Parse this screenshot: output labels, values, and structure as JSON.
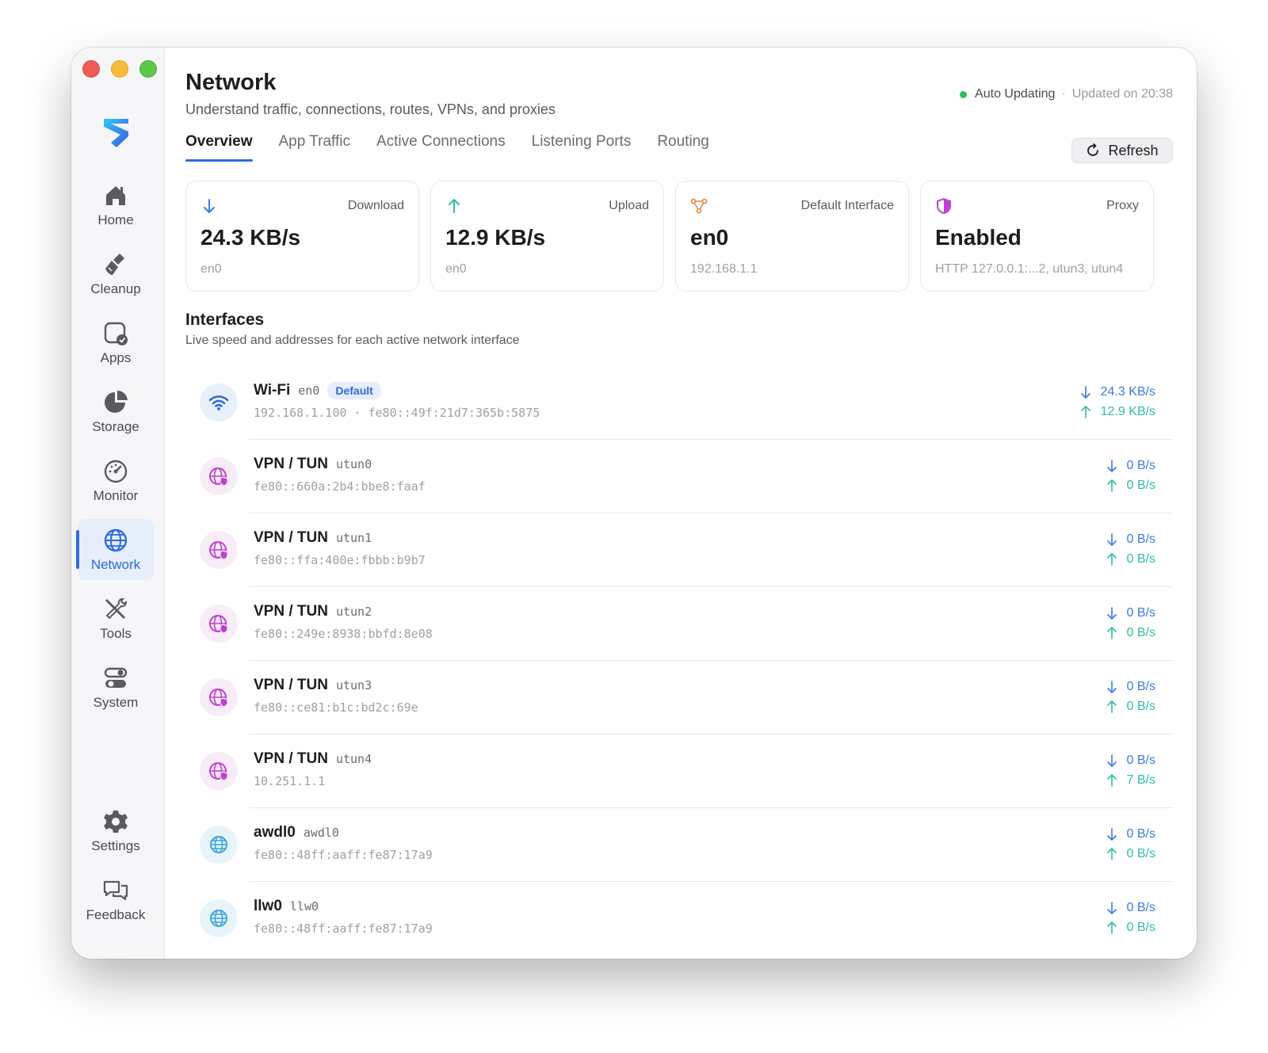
{
  "sidebar": {
    "items": [
      {
        "label": "Home",
        "icon": "house-icon"
      },
      {
        "label": "Cleanup",
        "icon": "broom-icon"
      },
      {
        "label": "Apps",
        "icon": "apps-icon"
      },
      {
        "label": "Storage",
        "icon": "pie-chart-icon"
      },
      {
        "label": "Monitor",
        "icon": "gauge-icon"
      },
      {
        "label": "Network",
        "icon": "globe-icon",
        "active": true
      },
      {
        "label": "Tools",
        "icon": "tools-icon"
      },
      {
        "label": "System",
        "icon": "toggles-icon"
      }
    ],
    "bottom": [
      {
        "label": "Settings",
        "icon": "gear-icon"
      },
      {
        "label": "Feedback",
        "icon": "chat-bubbles-icon"
      }
    ]
  },
  "header": {
    "title": "Network",
    "subtitle": "Understand traffic, connections, routes, VPNs, and proxies",
    "status_auto": "Auto Updating",
    "status_sep": "·",
    "status_updated": "Updated on 20:38",
    "refresh_label": "Refresh"
  },
  "tabs": [
    {
      "label": "Overview",
      "active": true
    },
    {
      "label": "App Traffic"
    },
    {
      "label": "Active Connections"
    },
    {
      "label": "Listening Ports"
    },
    {
      "label": "Routing"
    }
  ],
  "stats": {
    "download": {
      "label": "Download",
      "value": "24.3 KB/s",
      "sub": "en0"
    },
    "upload": {
      "label": "Upload",
      "value": "12.9 KB/s",
      "sub": "en0"
    },
    "interface": {
      "label": "Default Interface",
      "value": "en0",
      "sub": "192.168.1.1"
    },
    "proxy": {
      "label": "Proxy",
      "value": "Enabled",
      "sub": "HTTP 127.0.0.1:...2, utun3, utun4"
    }
  },
  "interfaces_section": {
    "title": "Interfaces",
    "subtitle": "Live speed and addresses for each active network interface"
  },
  "interfaces": [
    {
      "name": "Wi-Fi",
      "dev": "en0",
      "badge": "Default",
      "addr": "192.168.1.100  ·  fe80::49f:21d7:365b:5875",
      "down": "24.3 KB/s",
      "up": "12.9 KB/s"
    },
    {
      "name": "VPN / TUN",
      "dev": "utun0",
      "addr": "fe80::660a:2b4:bbe8:faaf",
      "down": "0 B/s",
      "up": "0 B/s"
    },
    {
      "name": "VPN / TUN",
      "dev": "utun1",
      "addr": "fe80::ffa:400e:fbbb:b9b7",
      "down": "0 B/s",
      "up": "0 B/s"
    },
    {
      "name": "VPN / TUN",
      "dev": "utun2",
      "addr": "fe80::249e:8938:bbfd:8e08",
      "down": "0 B/s",
      "up": "0 B/s"
    },
    {
      "name": "VPN / TUN",
      "dev": "utun3",
      "addr": "fe80::ce81:b1c:bd2c:69e",
      "down": "0 B/s",
      "up": "0 B/s"
    },
    {
      "name": "VPN / TUN",
      "dev": "utun4",
      "addr": "10.251.1.1",
      "down": "0 B/s",
      "up": "7 B/s"
    },
    {
      "name": "awdl0",
      "dev": "awdl0",
      "addr": "fe80::48ff:aaff:fe87:17a9",
      "down": "0 B/s",
      "up": "0 B/s"
    },
    {
      "name": "llw0",
      "dev": "llw0",
      "addr": "fe80::48ff:aaff:fe87:17a9",
      "down": "0 B/s",
      "up": "0 B/s"
    }
  ],
  "colors": {
    "accent": "#2e6be0",
    "download": "#3a7be8",
    "upload": "#2fbfa0",
    "vpn": "#c040d0",
    "status_dot": "#2fbf5b"
  }
}
